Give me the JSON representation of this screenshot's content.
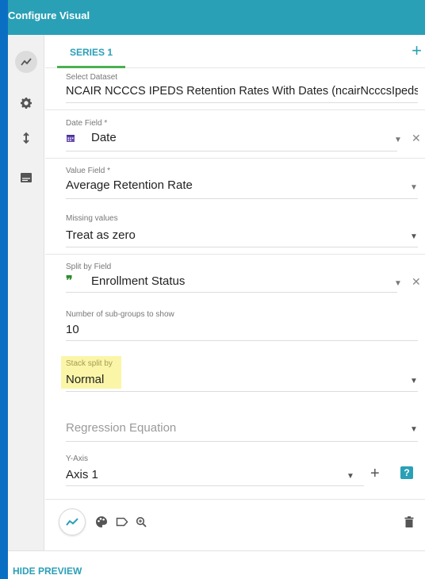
{
  "header": {
    "title": "Configure Visual"
  },
  "tabs": [
    {
      "label": "SERIES 1"
    }
  ],
  "add_series_symbol": "+",
  "fields": {
    "dataset": {
      "label": "Select Dataset",
      "value": "NCAIR NCCCS IPEDS Retention Rates With Dates (ncairNcccsIpedsRete"
    },
    "date_field": {
      "label": "Date Field *",
      "value": "Date"
    },
    "value_field": {
      "label": "Value Field *",
      "value": "Average Retention Rate"
    },
    "missing_values": {
      "label": "Missing values",
      "value": "Treat as zero"
    },
    "split_by_field": {
      "label": "Split by Field",
      "value": "Enrollment Status"
    },
    "subgroups": {
      "label": "Number of sub-groups to show",
      "value": "10"
    },
    "stack_split_by": {
      "label": "Stack split by",
      "value": "Normal"
    },
    "regression": {
      "placeholder": "Regression Equation"
    },
    "y_axis": {
      "label": "Y-Axis",
      "value": "Axis 1"
    }
  },
  "dropdown_arrow": "▼",
  "clear_symbol": "✕",
  "footer": {
    "hide_preview": "HIDE PREVIEW"
  },
  "colors": {
    "header": "#2aa0b6",
    "accent": "#2a9fb8",
    "tab_underline": "#4caf50",
    "highlight": "#fbf6a7",
    "outer": "#0a6fc2"
  }
}
